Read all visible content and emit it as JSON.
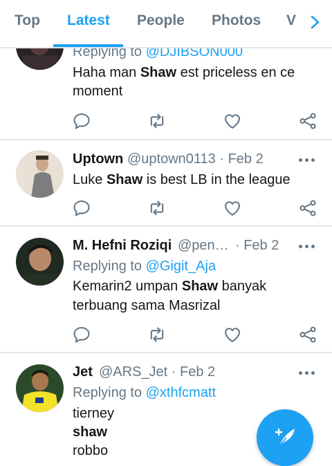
{
  "tabs": [
    {
      "label": "Top"
    },
    {
      "label": "Latest",
      "active": true
    },
    {
      "label": "People"
    },
    {
      "label": "Photos"
    },
    {
      "label": "V"
    }
  ],
  "tweets": [
    {
      "replying_prefix": "Replying to ",
      "replying_to": "@DJIBSON000",
      "text_parts": [
        "Haha man ",
        "Shaw",
        " est priceless en ce"
      ],
      "text_line2": "moment"
    },
    {
      "name": "Uptown",
      "handle": "@uptown0113 · Feb 2",
      "text_parts": [
        "Luke ",
        "Shaw",
        " is best LB in the league"
      ]
    },
    {
      "name": "M. Hefni Roziqi",
      "handle": "@pen…",
      "date": "· Feb 2",
      "replying_prefix": "Replying to ",
      "replying_to": "@Gigit_Aja",
      "text_parts": [
        "Kemarin2 umpan ",
        "Shaw",
        " banyak"
      ],
      "text_line2": "terbuang sama Masrizal"
    },
    {
      "name": "Jet",
      "handle": "@ARS_Jet · Feb 2",
      "replying_prefix": "Replying to ",
      "replying_to": "@xthfcmatt",
      "lines": [
        "tierney",
        "shaw",
        "robbo"
      ]
    }
  ],
  "icons": {
    "reply": "reply-icon",
    "retweet": "retweet-icon",
    "like": "heart-icon",
    "share": "share-icon",
    "more": "more-icon",
    "compose": "compose-icon",
    "next": "chevron-right-icon"
  },
  "colors": {
    "accent": "#1da1f2",
    "secondary_text": "#657786",
    "primary_text": "#14171a",
    "divider": "#e1e8ed"
  }
}
